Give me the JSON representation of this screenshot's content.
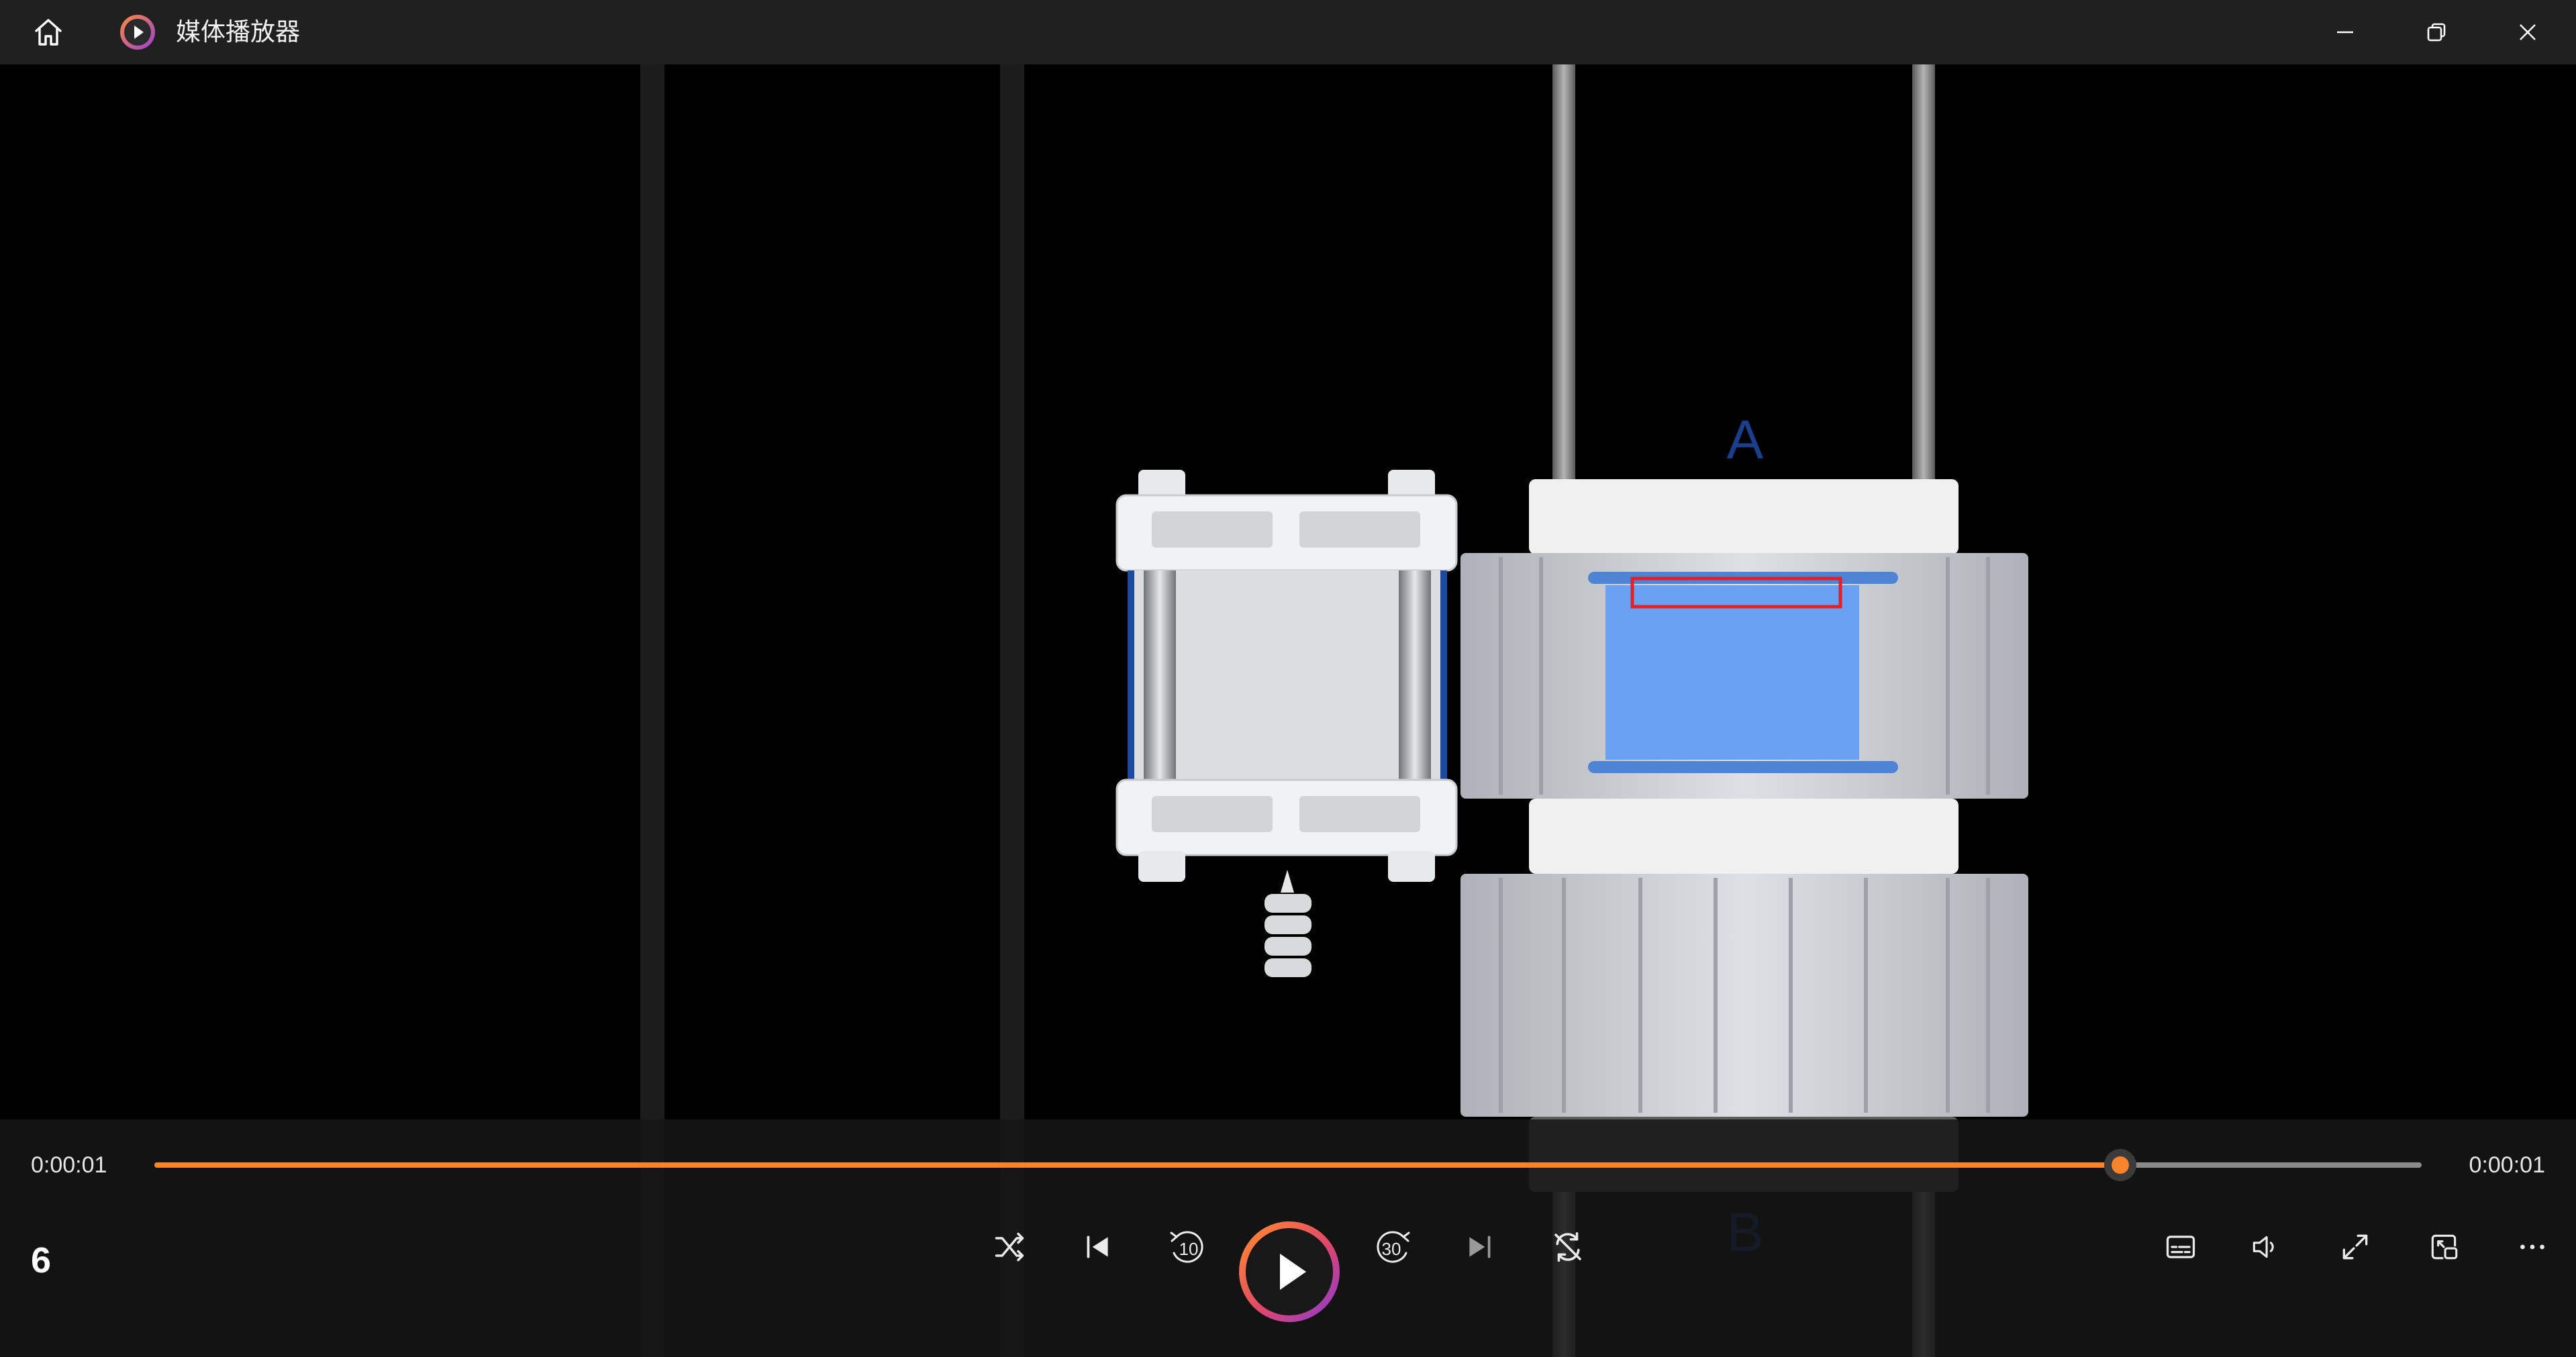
{
  "app": {
    "title": "媒体播放器",
    "accent_color": "#f7832c",
    "icons": [
      "home-icon",
      "app-logo-icon",
      "minimize-icon",
      "restore-icon",
      "close-icon"
    ]
  },
  "video": {
    "label_a": "A",
    "label_b": "B"
  },
  "player": {
    "current_time": "0:00:01",
    "total_time": "0:00:01",
    "progress": 0.867,
    "counter": "6",
    "rewind_label": "10",
    "forward_label": "30",
    "controls": [
      "shuffle-icon",
      "previous-icon",
      "rewind-10-icon",
      "play-icon",
      "forward-30-icon",
      "next-icon",
      "repeat-icon",
      "subtitles-icon",
      "volume-icon",
      "fullscreen-icon",
      "mini-player-icon",
      "more-icon"
    ]
  }
}
